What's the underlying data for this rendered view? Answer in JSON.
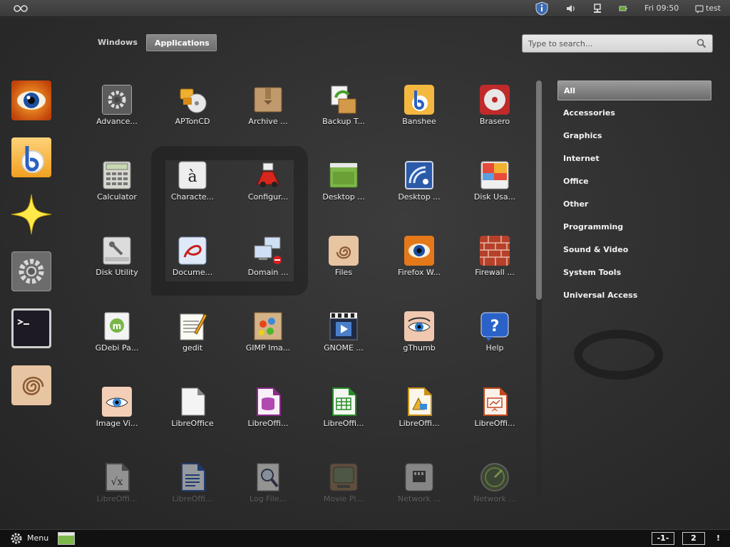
{
  "top_panel": {
    "clock": "Fri 09:50",
    "user": "test",
    "icons": [
      "activities-icon",
      "update-manager-icon",
      "volume-icon",
      "network-icon",
      "battery-icon",
      "user-icon"
    ]
  },
  "view_selector": {
    "windows": "Windows",
    "applications": "Applications",
    "selected": "Applications"
  },
  "search": {
    "placeholder": "Type to search..."
  },
  "dash": {
    "items": [
      {
        "icon": "firefox-icon"
      },
      {
        "icon": "banshee-icon"
      },
      {
        "icon": "star-icon"
      },
      {
        "icon": "settings-icon"
      },
      {
        "icon": "terminal-icon"
      },
      {
        "icon": "files-icon"
      }
    ]
  },
  "apps": [
    {
      "label": "Advance...",
      "icon": "gear-icon"
    },
    {
      "label": "APTonCD",
      "icon": "aptoncd-icon"
    },
    {
      "label": "Archive ...",
      "icon": "archive-icon"
    },
    {
      "label": "Backup T...",
      "icon": "backup-icon"
    },
    {
      "label": "Banshee",
      "icon": "banshee-icon"
    },
    {
      "label": "Brasero",
      "icon": "brasero-icon"
    },
    {
      "label": "Calculator",
      "icon": "calculator-icon"
    },
    {
      "label": "Characte...",
      "icon": "character-map-icon"
    },
    {
      "label": "Configur...",
      "icon": "configure-icon"
    },
    {
      "label": "Desktop ...",
      "icon": "desktop-icon"
    },
    {
      "label": "Desktop ...",
      "icon": "remote-desktop-icon"
    },
    {
      "label": "Disk Usa...",
      "icon": "disk-usage-icon"
    },
    {
      "label": "Disk Utility",
      "icon": "disk-utility-icon"
    },
    {
      "label": "Docume...",
      "icon": "document-viewer-icon"
    },
    {
      "label": "Domain ...",
      "icon": "domain-icon"
    },
    {
      "label": "Files",
      "icon": "files-icon"
    },
    {
      "label": "Firefox W...",
      "icon": "firefox-icon"
    },
    {
      "label": "Firewall ...",
      "icon": "firewall-icon"
    },
    {
      "label": "GDebi Pa...",
      "icon": "gdebi-icon"
    },
    {
      "label": "gedit",
      "icon": "gedit-icon"
    },
    {
      "label": "GIMP Ima...",
      "icon": "gimp-icon"
    },
    {
      "label": "GNOME ...",
      "icon": "video-icon"
    },
    {
      "label": "gThumb",
      "icon": "gthumb-icon"
    },
    {
      "label": "Help",
      "icon": "help-icon"
    },
    {
      "label": "Image Vi...",
      "icon": "image-viewer-icon"
    },
    {
      "label": "LibreOffice",
      "icon": "libreoffice-icon"
    },
    {
      "label": "LibreOffi...",
      "icon": "libreoffice-base-icon"
    },
    {
      "label": "LibreOffi...",
      "icon": "libreoffice-calc-icon"
    },
    {
      "label": "LibreOffi...",
      "icon": "libreoffice-draw-icon"
    },
    {
      "label": "LibreOffi...",
      "icon": "libreoffice-impress-icon"
    },
    {
      "label": "LibreOffi...",
      "icon": "libreoffice-math-icon"
    },
    {
      "label": "LibreOffi...",
      "icon": "libreoffice-writer-icon"
    },
    {
      "label": "Log File...",
      "icon": "log-viewer-icon"
    },
    {
      "label": "Movie Pl...",
      "icon": "movie-player-icon"
    },
    {
      "label": "Network ...",
      "icon": "network-tools-icon"
    },
    {
      "label": "Network ...",
      "icon": "network-icon"
    }
  ],
  "categories": [
    {
      "label": "All",
      "selected": true
    },
    {
      "label": "Accessories"
    },
    {
      "label": "Graphics"
    },
    {
      "label": "Internet"
    },
    {
      "label": "Office"
    },
    {
      "label": "Other"
    },
    {
      "label": "Programming"
    },
    {
      "label": "Sound & Video"
    },
    {
      "label": "System Tools"
    },
    {
      "label": "Universal Access"
    }
  ],
  "bottom_panel": {
    "menu_label": "Menu",
    "workspaces": [
      "-1-",
      "2"
    ],
    "notification": "!"
  }
}
